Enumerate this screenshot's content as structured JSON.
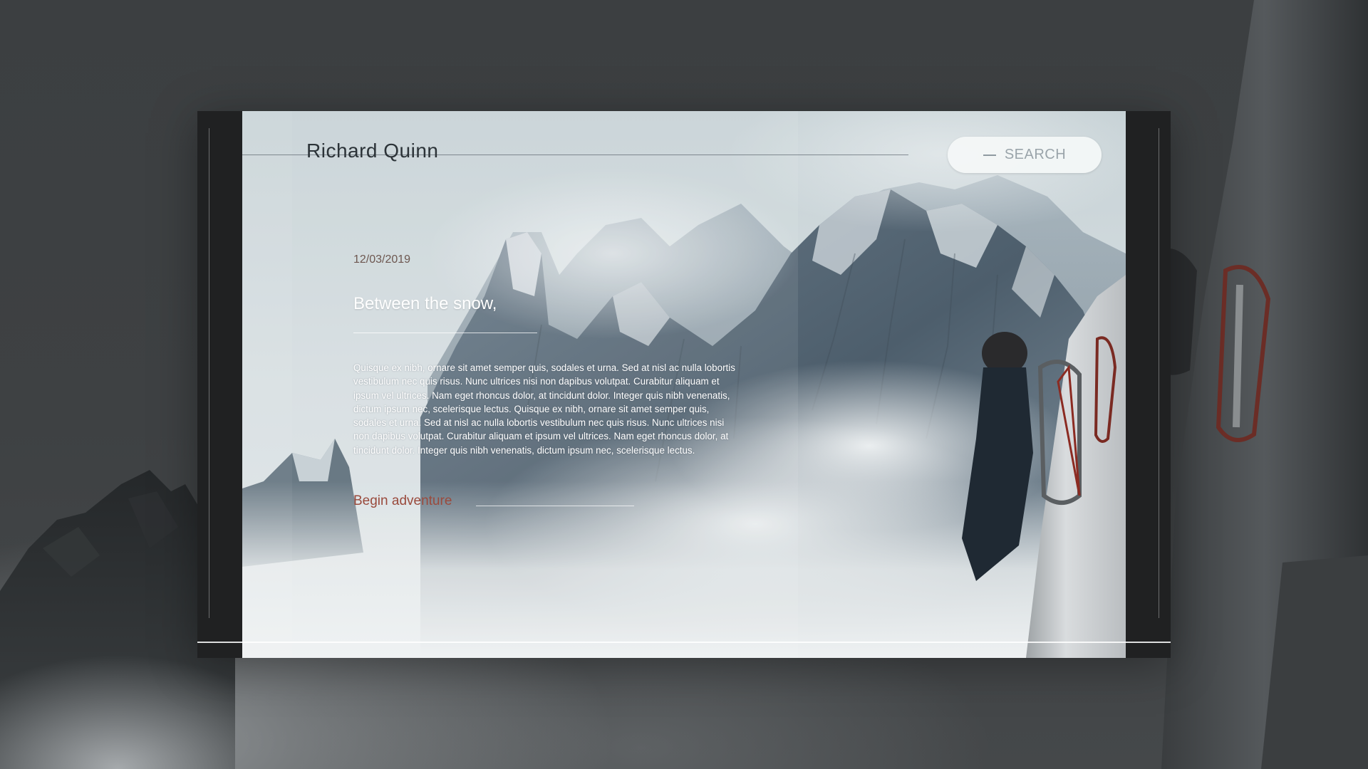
{
  "header": {
    "brand": "Richard Quinn",
    "search_label": "SEARCH"
  },
  "article": {
    "date": "12/03/2019",
    "title": "Between the snow,",
    "body": "Quisque ex nibh, ornare sit amet semper quis, sodales et urna. Sed at nisl ac nulla lobortis vestibulum nec quis risus. Nunc ultrices nisi non dapibus volutpat. Curabitur aliquam et ipsum vel ultrices. Nam eget rhoncus dolor, at tincidunt dolor. Integer quis nibh venenatis, dictum ipsum nec, scelerisque lectus. Quisque ex nibh, ornare sit amet semper quis, sodales et urna. Sed at nisl ac nulla lobortis vestibulum nec quis risus. Nunc ultrices nisi non dapibus volutpat. Curabitur aliquam et ipsum vel ultrices. Nam eget rhoncus dolor, at tincidunt dolor. Integer quis nibh venenatis, dictum ipsum nec, scelerisque lectus.",
    "cta_label": "Begin adventure"
  },
  "theme": {
    "accent": "#9a4a3c",
    "card_frame": "#202122",
    "page_background": "#3a3d3f"
  },
  "icons": {
    "search": "search-dash-icon"
  }
}
